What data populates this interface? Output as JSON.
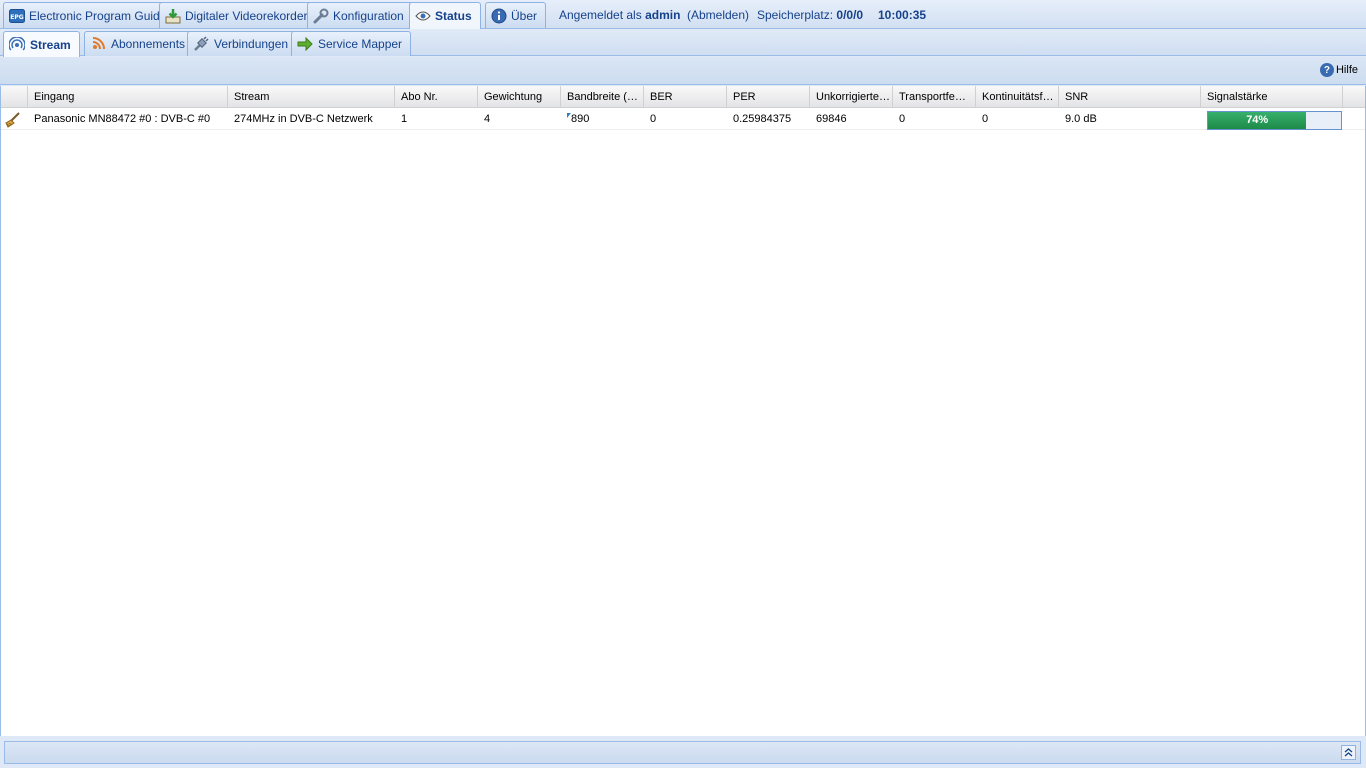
{
  "top_tabs": [
    {
      "label": "Electronic Program Guide",
      "icon": "epg-icon"
    },
    {
      "label": "Digitaler Videorekorder",
      "icon": "download-icon"
    },
    {
      "label": "Konfiguration",
      "icon": "wrench-icon"
    },
    {
      "label": "Status",
      "icon": "eye-icon",
      "active": true
    },
    {
      "label": "Über",
      "icon": "info-icon"
    }
  ],
  "login": {
    "prefix": "Angemeldet als",
    "user": "admin",
    "logout": "(Abmelden)",
    "storage_label": "Speicherplatz:",
    "storage_value": "0/0/0",
    "time": "10:00:35"
  },
  "sub_tabs": [
    {
      "label": "Stream",
      "icon": "stream-icon",
      "active": true
    },
    {
      "label": "Abonnements",
      "icon": "subscriptions-icon"
    },
    {
      "label": "Verbindungen",
      "icon": "plug-icon"
    },
    {
      "label": "Service Mapper",
      "icon": "arrow-right-icon"
    }
  ],
  "toolbar": {
    "help_label": "Hilfe"
  },
  "grid": {
    "columns": [
      "Eingang",
      "Stream",
      "Abo Nr.",
      "Gewichtung",
      "Bandbreite (…",
      "BER",
      "PER",
      "Unkorrigierte…",
      "Transportfe…",
      "Kontinuitätsf…",
      "SNR",
      "Signalstärke"
    ],
    "rows": [
      {
        "eingang": "Panasonic MN88472 #0 : DVB-C #0",
        "stream": "274MHz in DVB-C Netzwerk",
        "abo_nr": "1",
        "gewichtung": "4",
        "bandbreite": "890",
        "ber": "0",
        "per": "0.25984375",
        "unkorrigierte": "69846",
        "transportfehler": "0",
        "kontinuitaetsfehler": "0",
        "snr": "9.0 dB",
        "signal_label": "74%",
        "signal_fraction": 0.74
      }
    ]
  },
  "colors": {
    "accent": "#15428b",
    "signal_fill": "#1e8a48",
    "border": "#99bbe8"
  }
}
